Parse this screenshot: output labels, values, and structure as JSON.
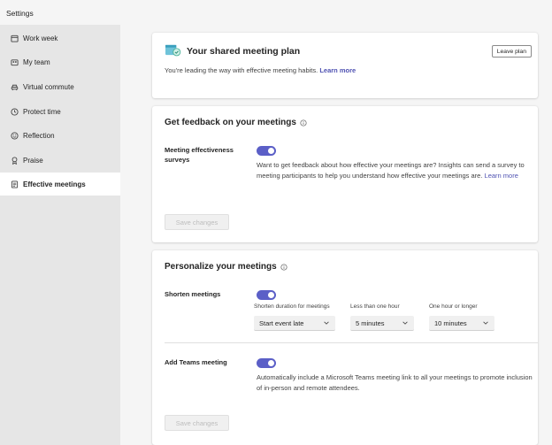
{
  "app": {
    "title": "Settings"
  },
  "sidebar": {
    "items": [
      {
        "label": "Work week",
        "icon": "calendar-icon"
      },
      {
        "label": "My team",
        "icon": "team-icon"
      },
      {
        "label": "Virtual commute",
        "icon": "car-icon"
      },
      {
        "label": "Protect time",
        "icon": "clock-icon"
      },
      {
        "label": "Reflection",
        "icon": "smiley-icon"
      },
      {
        "label": "Praise",
        "icon": "ribbon-icon"
      },
      {
        "label": "Effective meetings",
        "icon": "notepad-icon",
        "active": true
      }
    ]
  },
  "plan_card": {
    "title": "Your shared meeting plan",
    "description": "You're leading the way with effective meeting habits.",
    "learn_more": "Learn more",
    "leave_button": "Leave plan"
  },
  "feedback_card": {
    "title": "Get feedback on your meetings",
    "surveys_label_line1": "Meeting effectiveness",
    "surveys_label_line2": "surveys",
    "surveys_enabled": true,
    "surveys_desc": "Want to get feedback about how effective your meetings are? Insights can send a survey to meeting participants to help you understand how effective your meetings are.",
    "learn_more": "Learn more",
    "save_button": "Save changes"
  },
  "personalize_card": {
    "title": "Personalize your meetings",
    "shorten_label": "Shorten meetings",
    "shorten_enabled": true,
    "dropdowns": [
      {
        "label": "Shorten duration for meetings",
        "value": "Start event late"
      },
      {
        "label": "Less than one hour",
        "value": "5 minutes"
      },
      {
        "label": "One hour or longer",
        "value": "10 minutes"
      }
    ],
    "teams_label": "Add Teams meeting",
    "teams_enabled": true,
    "teams_desc": "Automatically include a Microsoft Teams meeting link to all your meetings to promote inclusion of in-person and remote attendees.",
    "save_button": "Save changes"
  },
  "colors": {
    "accent": "#5b5fc7",
    "link": "#4f52b2",
    "sidebar_bg": "#e6e6e6"
  }
}
